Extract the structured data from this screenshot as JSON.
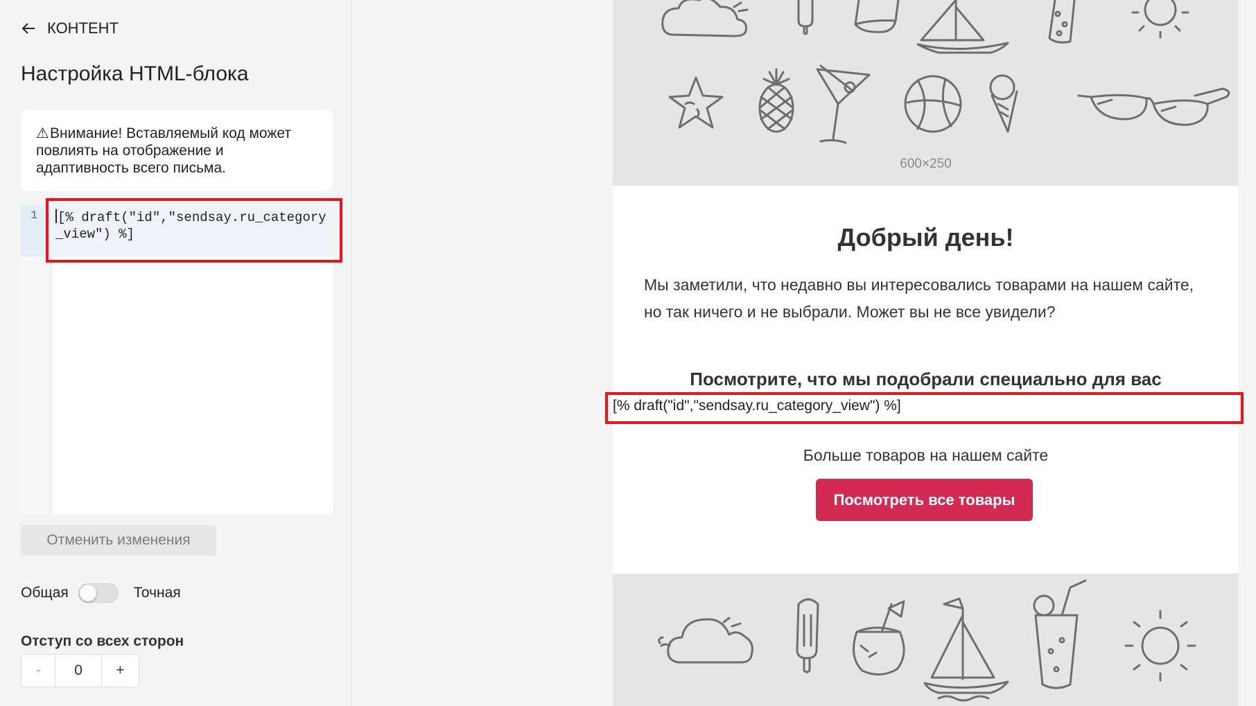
{
  "sidebar": {
    "back_label": "КОНТЕНТ",
    "title": "Настройка HTML-блока",
    "warning_text": "Внимание! Вставляемый код может повлиять на отображение и адаптивность всего письма.",
    "editor": {
      "line_number": "1",
      "code": "[% draft(\"id\",\"sendsay.ru_category_view\") %]"
    },
    "reset_label": "Отменить изменения",
    "toggle": {
      "left_label": "Общая",
      "right_label": "Точная",
      "on": false
    },
    "padding_label": "Отступ со всех сторон",
    "stepper": {
      "minus": "-",
      "value": "0",
      "plus": "+"
    }
  },
  "email": {
    "banner_size_label": "600×250",
    "greeting": "Добрый день!",
    "intro": "Мы заметили, что недавно вы интересовались товарами на нашем сайте, но так ничего и не выбрали. Может вы не все увидели?",
    "subheading": "Посмотрите, что мы подобрали специально для вас",
    "code_output": "[% draft(\"id\",\"sendsay.ru_category_view\") %]",
    "more_text": "Больше товаров на нашем сайте",
    "cta_label": "Посмотреть все товары"
  },
  "colors": {
    "accent": "#d22a52",
    "highlight_frame": "#e8141e",
    "banner_bg": "#e5e5e5"
  }
}
